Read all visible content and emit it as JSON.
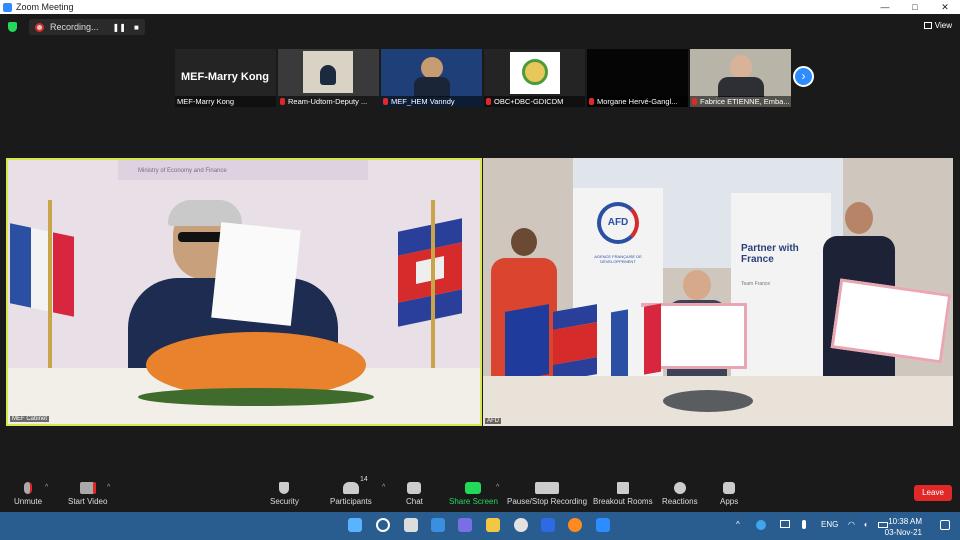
{
  "window": {
    "title": "Zoom Meeting",
    "minimize": "—",
    "maximize": "□",
    "close": "✕"
  },
  "topbar": {
    "recording_label": "Recording...",
    "pause_label": "❚❚",
    "stop_label": "■",
    "view_label": "View"
  },
  "participants_strip": [
    {
      "name": "MEF-Marry Kong",
      "display": "MEF-Marry Kong",
      "muted": false
    },
    {
      "name": "Ream-Udtom-Deputy ...",
      "muted": true
    },
    {
      "name": "MEF_HEM Vanndy",
      "muted": true
    },
    {
      "name": "OBC+DBC-GDICDM",
      "muted": true
    },
    {
      "name": "Morgane Hervé-Gangl...",
      "muted": true
    },
    {
      "name": "Fabrice ETIENNE, Emba...",
      "muted": true
    }
  ],
  "next_icon": "›",
  "video_labels": {
    "left": "MEF Cabinet",
    "right": "AFD"
  },
  "video_left": {
    "banner_text": "Ministry of Economy and Finance"
  },
  "video_right": {
    "afd_text": "AFD",
    "afd_sub": "AGENCE FRANÇAISE DE DÉVELOPPEMENT",
    "partner_title": "Partner with France",
    "partner_sub": "Team France"
  },
  "toolbar": {
    "unmute": "Unmute",
    "start_video": "Start Video",
    "security": "Security",
    "participants": "Participants",
    "participants_count": "14",
    "chat": "Chat",
    "share_screen": "Share Screen",
    "pause_recording": "Pause/Stop Recording",
    "breakout_rooms": "Breakout Rooms",
    "reactions": "Reactions",
    "apps": "Apps",
    "leave": "Leave"
  },
  "taskbar": {
    "lang": "ENG",
    "time": "10:38 AM",
    "date": "03-Nov-21"
  },
  "colors": {
    "accent": "#2d8cff",
    "leave": "#e02828",
    "share_green": "#23d959",
    "active_speaker": "#d7e84a"
  }
}
